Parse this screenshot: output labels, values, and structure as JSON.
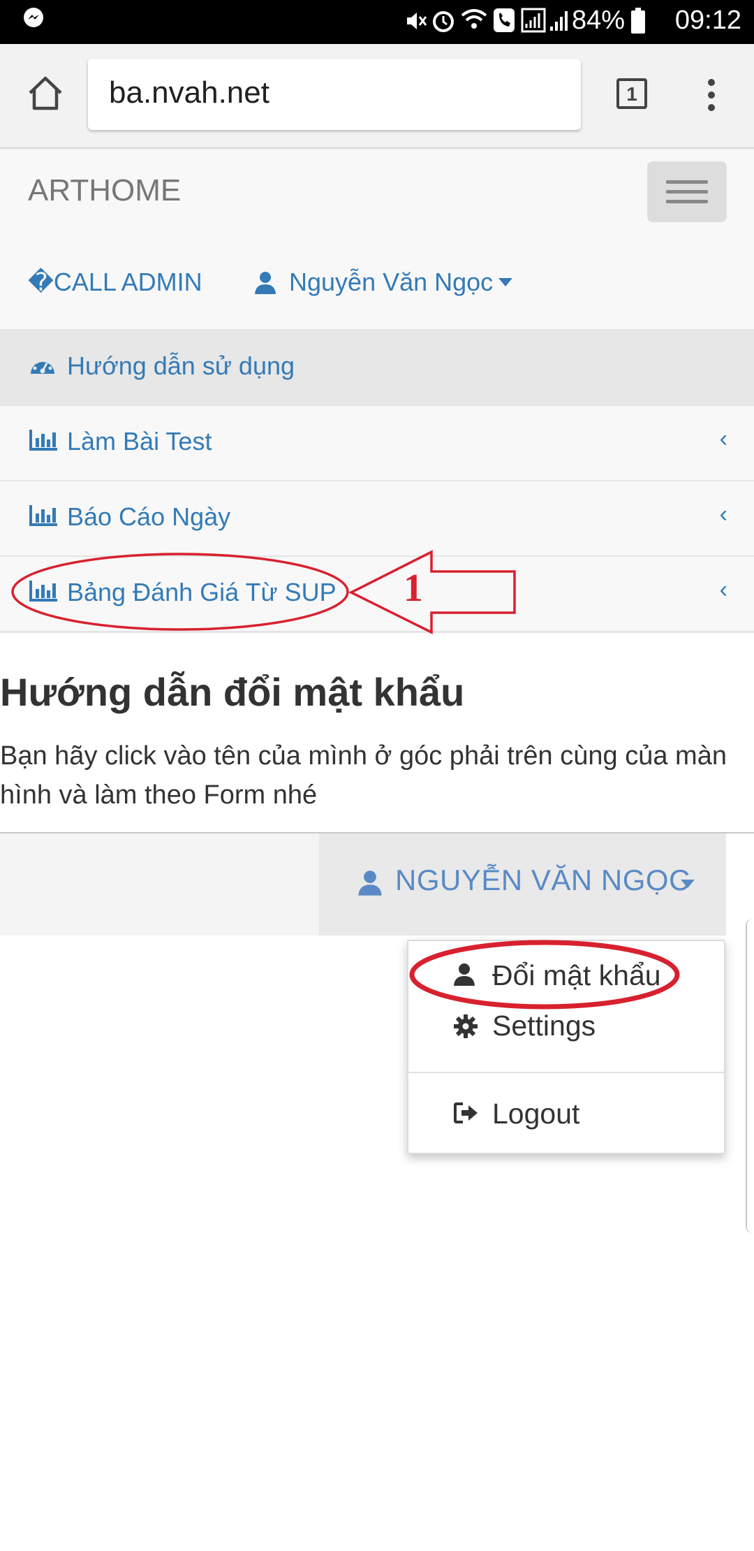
{
  "status_bar": {
    "battery": "84%",
    "time": "09:12",
    "icons": [
      "messenger-icon",
      "mute-icon",
      "alarm-icon",
      "wifi-icon",
      "call-icon",
      "signal-icon",
      "battery-icon"
    ]
  },
  "browser": {
    "url": "ba.nvah.net",
    "tab_count": "1"
  },
  "navbar": {
    "brand": "ARTHOME",
    "call_admin": "�CALL ADMIN",
    "user_name": "Nguyễn Văn Ngọc"
  },
  "menu": {
    "items": [
      {
        "label": "Hướng dẫn sử dụng",
        "icon": "dashboard-icon"
      },
      {
        "label": "Làm Bài Test",
        "icon": "bar-chart-icon"
      },
      {
        "label": "Báo Cáo Ngày",
        "icon": "bar-chart-icon"
      },
      {
        "label": "Bảng Đánh Giá Từ SUP",
        "icon": "bar-chart-icon"
      }
    ],
    "chevron": "‹"
  },
  "content": {
    "title": "Hướng dẫn đổi mật khẩu",
    "description": "Bạn hãy click vào tên của mình ở góc phải trên cùng của màn hình và làm theo Form nhé"
  },
  "screenshot": {
    "user_name": "NGUYỄN VĂN NGỌC",
    "dropdown": {
      "change_password": "Đổi mật khẩu",
      "settings": "Settings",
      "logout": "Logout"
    }
  },
  "annotation": {
    "step_number": "1",
    "accent_color": "#d8212f"
  },
  "colors": {
    "link": "#337ab7",
    "status_bar": "#000000"
  }
}
